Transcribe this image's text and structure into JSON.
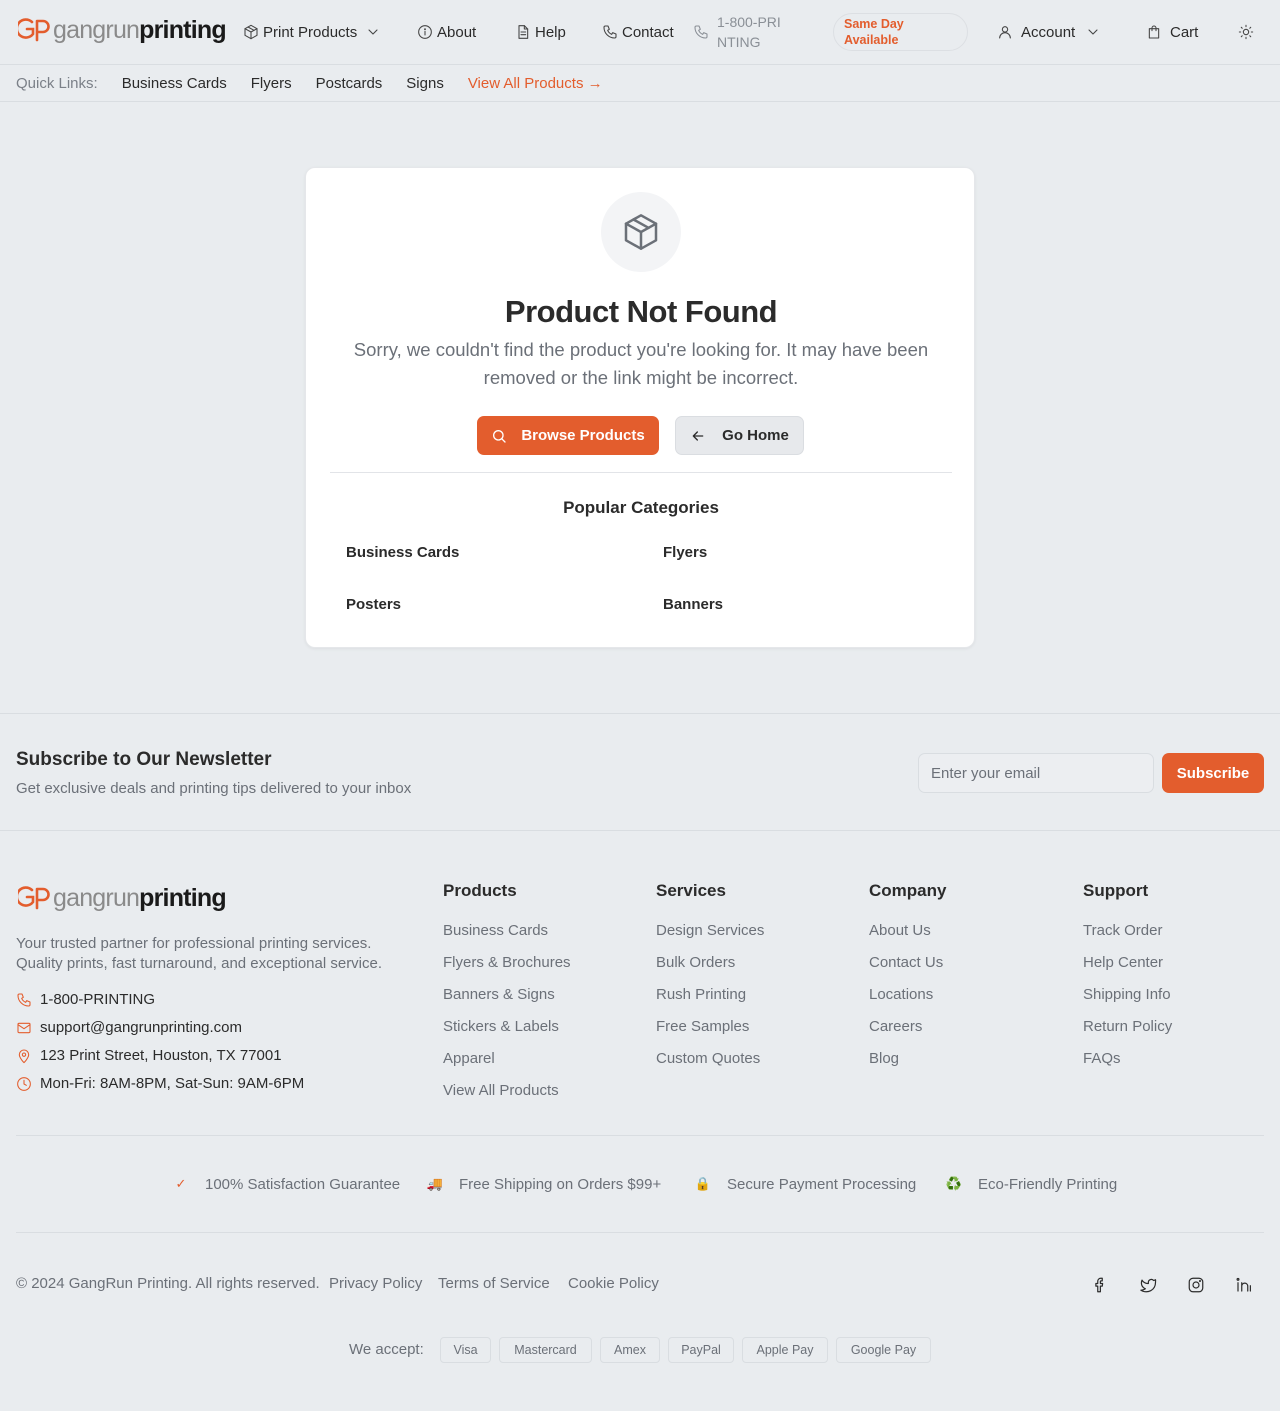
{
  "brand": {
    "logo_light": "gangrun",
    "logo_bold": "printing",
    "accent": "#e35d2d"
  },
  "header": {
    "nav": {
      "print_products": "Print Products",
      "about": "About",
      "help": "Help",
      "contact": "Contact",
      "phone": "1-800-PRINTING",
      "same_day": "Same Day Available",
      "account": "Account",
      "cart": "Cart"
    }
  },
  "quick_links": {
    "label": "Quick Links:",
    "items": [
      "Business Cards",
      "Flyers",
      "Postcards",
      "Signs"
    ],
    "view_all": "View All Products →"
  },
  "not_found": {
    "icon": "package-icon",
    "title": "Product Not Found",
    "message": "Sorry, we couldn't find the product you're looking for. It may have been removed or the link might be incorrect.",
    "browse_button": "Browse Products",
    "home_button": "Go Home",
    "popular_title": "Popular Categories",
    "categories": [
      "Business Cards",
      "Flyers",
      "Posters",
      "Banners"
    ]
  },
  "newsletter": {
    "title": "Subscribe to Our Newsletter",
    "subtitle": "Get exclusive deals and printing tips delivered to your inbox",
    "placeholder": "Enter your email",
    "button": "Subscribe"
  },
  "footer": {
    "description": "Your trusted partner for professional printing services. Quality prints, fast turnaround, and exceptional service.",
    "contact": {
      "phone": "1-800-PRINTING",
      "email": "support@gangrunprinting.com",
      "address": "123 Print Street, Houston, TX 77001",
      "hours": "Mon-Fri: 8AM-8PM, Sat-Sun: 9AM-6PM"
    },
    "columns": [
      {
        "title": "Products",
        "links": [
          "Business Cards",
          "Flyers & Brochures",
          "Banners & Signs",
          "Stickers & Labels",
          "Apparel",
          "View All Products"
        ]
      },
      {
        "title": "Services",
        "links": [
          "Design Services",
          "Bulk Orders",
          "Rush Printing",
          "Free Samples",
          "Custom Quotes"
        ]
      },
      {
        "title": "Company",
        "links": [
          "About Us",
          "Contact Us",
          "Locations",
          "Careers",
          "Blog"
        ]
      },
      {
        "title": "Support",
        "links": [
          "Track Order",
          "Help Center",
          "Shipping Info",
          "Return Policy",
          "FAQs"
        ]
      }
    ],
    "trust": [
      {
        "icon": "✓",
        "text": "100% Satisfaction Guarantee"
      },
      {
        "icon": "🚚",
        "text": "Free Shipping on Orders $99+"
      },
      {
        "icon": "🔒",
        "text": "Secure Payment Processing"
      },
      {
        "icon": "♻️",
        "text": "Eco-Friendly Printing"
      }
    ],
    "copyright": "© 2024 GangRun Printing. All rights reserved.",
    "legal": [
      "Privacy Policy",
      "Terms of Service",
      "Cookie Policy"
    ],
    "social": [
      "facebook-icon",
      "twitter-icon",
      "instagram-icon",
      "linkedin-icon"
    ],
    "we_accept": "We accept:",
    "payments": [
      "Visa",
      "Mastercard",
      "Amex",
      "PayPal",
      "Apple Pay",
      "Google Pay"
    ]
  }
}
